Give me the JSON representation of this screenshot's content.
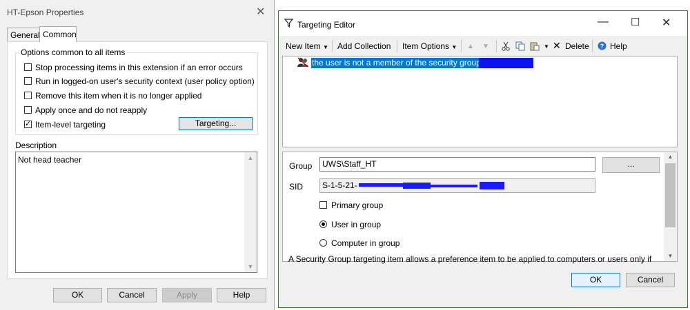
{
  "left_dialog": {
    "title": "HT-Epson Properties",
    "close_glyph": "✕",
    "tabs": [
      {
        "label": "General"
      },
      {
        "label": "Common"
      }
    ],
    "group_label": "Options common to all items",
    "options": [
      {
        "label": "Stop processing items in this extension if an error occurs",
        "checked": false
      },
      {
        "label": "Run in logged-on user's security context (user policy option)",
        "checked": false
      },
      {
        "label": "Remove this item when it is no longer applied",
        "checked": false
      },
      {
        "label": "Apply once and do not reapply",
        "checked": false
      },
      {
        "label": "Item-level targeting",
        "checked": true
      }
    ],
    "targeting_button": "Targeting...",
    "description_label": "Description",
    "description_value": "Not head teacher",
    "buttons": {
      "ok": "OK",
      "cancel": "Cancel",
      "apply": "Apply",
      "help": "Help"
    }
  },
  "editor": {
    "title": "Targeting Editor",
    "window_controls": {
      "minimize": "—",
      "maximize": "☐",
      "close": "✕"
    },
    "toolbar": {
      "new_item": "New Item",
      "add_collection": "Add Collection",
      "item_options": "Item Options",
      "delete": "Delete",
      "help": "Help"
    },
    "tree_item": "the user is not a member of the security group ",
    "fields": {
      "group_label": "Group",
      "group_value": "UWS\\Staff_HT",
      "browse": "...",
      "sid_label": "SID",
      "sid_value": "S-1-5-21-"
    },
    "primary_group": {
      "label": "Primary group",
      "checked": false
    },
    "radio_options": [
      {
        "label": "User in group",
        "selected": true
      },
      {
        "label": "Computer in group",
        "selected": false
      }
    ],
    "info_text": "A Security Group targeting item allows a preference item to be applied to computers or users only if",
    "buttons": {
      "ok": "OK",
      "cancel": "Cancel"
    }
  },
  "colors": {
    "selection": "#0078d7",
    "focus_border": "#0078d7",
    "window_border": "#3a7d2e"
  }
}
